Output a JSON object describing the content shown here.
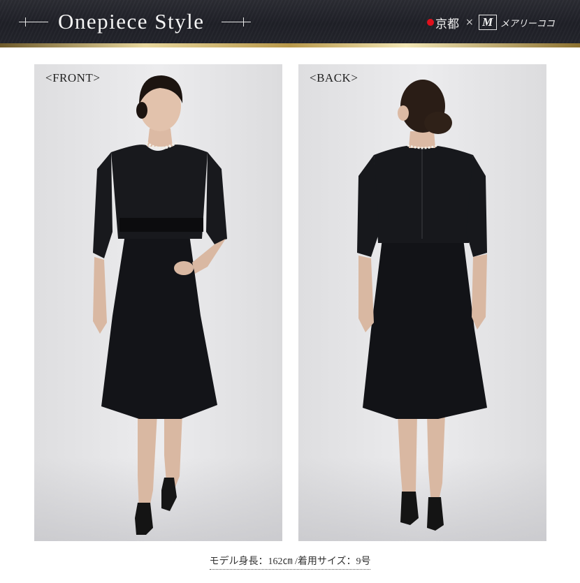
{
  "header": {
    "title": "Onepiece Style",
    "brand_kyoto": "京都",
    "brand_times": "×",
    "brand_logo_letter": "M",
    "brand_name": "メアリーココ",
    "colors": {
      "banner": "#22232a",
      "gold": "#d9c27c",
      "accent_dot": "#e0101c"
    }
  },
  "photos": {
    "front_label": "<FRONT>",
    "back_label": "<BACK>"
  },
  "caption": "モデル身長：162㎝ /着用サイズ：9号"
}
